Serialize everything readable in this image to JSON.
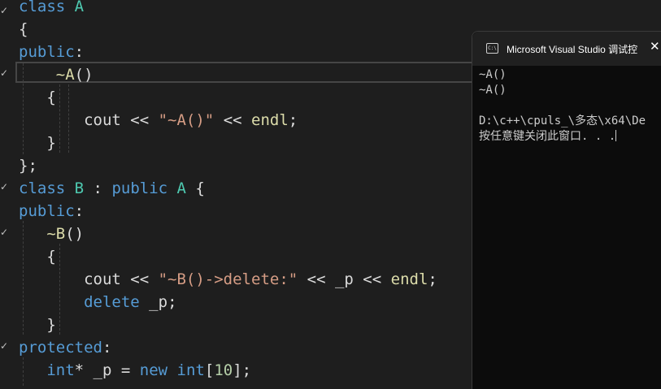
{
  "editor": {
    "lines": [
      {
        "tokens": [
          {
            "c": "k",
            "t": "class"
          },
          {
            "c": "p",
            "t": " "
          },
          {
            "c": "t",
            "t": "A"
          }
        ]
      },
      {
        "tokens": [
          {
            "c": "p",
            "t": "{"
          }
        ]
      },
      {
        "tokens": [
          {
            "c": "k",
            "t": "public"
          },
          {
            "c": "p",
            "t": ":"
          }
        ]
      },
      {
        "tokens": [
          {
            "c": "p",
            "t": "    "
          },
          {
            "c": "f",
            "t": "~A"
          },
          {
            "c": "p",
            "t": "()"
          }
        ]
      },
      {
        "tokens": [
          {
            "c": "p",
            "t": "   {"
          }
        ]
      },
      {
        "tokens": [
          {
            "c": "p",
            "t": "       "
          },
          {
            "c": "v",
            "t": "cout"
          },
          {
            "c": "p",
            "t": " << "
          },
          {
            "c": "s",
            "t": "\"~A()\""
          },
          {
            "c": "p",
            "t": " << "
          },
          {
            "c": "f",
            "t": "endl"
          },
          {
            "c": "p",
            "t": ";"
          }
        ]
      },
      {
        "tokens": [
          {
            "c": "p",
            "t": "   }"
          }
        ]
      },
      {
        "tokens": [
          {
            "c": "p",
            "t": "};"
          }
        ]
      },
      {
        "tokens": [
          {
            "c": "k",
            "t": "class"
          },
          {
            "c": "p",
            "t": " "
          },
          {
            "c": "t",
            "t": "B"
          },
          {
            "c": "p",
            "t": " : "
          },
          {
            "c": "k",
            "t": "public"
          },
          {
            "c": "p",
            "t": " "
          },
          {
            "c": "t",
            "t": "A"
          },
          {
            "c": "p",
            "t": " {"
          }
        ]
      },
      {
        "tokens": [
          {
            "c": "k",
            "t": "public"
          },
          {
            "c": "p",
            "t": ":"
          }
        ]
      },
      {
        "tokens": [
          {
            "c": "p",
            "t": "   "
          },
          {
            "c": "f",
            "t": "~B"
          },
          {
            "c": "p",
            "t": "()"
          }
        ]
      },
      {
        "tokens": [
          {
            "c": "p",
            "t": "   {"
          }
        ]
      },
      {
        "tokens": [
          {
            "c": "p",
            "t": "       "
          },
          {
            "c": "v",
            "t": "cout"
          },
          {
            "c": "p",
            "t": " << "
          },
          {
            "c": "s",
            "t": "\"~B()->delete:\""
          },
          {
            "c": "p",
            "t": " << "
          },
          {
            "c": "v",
            "t": "_p"
          },
          {
            "c": "p",
            "t": " << "
          },
          {
            "c": "f",
            "t": "endl"
          },
          {
            "c": "p",
            "t": ";"
          }
        ]
      },
      {
        "tokens": [
          {
            "c": "p",
            "t": "       "
          },
          {
            "c": "k",
            "t": "delete"
          },
          {
            "c": "p",
            "t": " "
          },
          {
            "c": "v",
            "t": "_p"
          },
          {
            "c": "p",
            "t": ";"
          }
        ]
      },
      {
        "tokens": [
          {
            "c": "p",
            "t": "   }"
          }
        ]
      },
      {
        "tokens": [
          {
            "c": "k",
            "t": "protected"
          },
          {
            "c": "p",
            "t": ":"
          }
        ]
      },
      {
        "tokens": [
          {
            "c": "p",
            "t": "   "
          },
          {
            "c": "k",
            "t": "int"
          },
          {
            "c": "p",
            "t": "* "
          },
          {
            "c": "v",
            "t": "_p"
          },
          {
            "c": "p",
            "t": " = "
          },
          {
            "c": "k",
            "t": "new"
          },
          {
            "c": "p",
            "t": " "
          },
          {
            "c": "k",
            "t": "int"
          },
          {
            "c": "p",
            "t": "["
          },
          {
            "c": "n",
            "t": "10"
          },
          {
            "c": "p",
            "t": "];"
          }
        ]
      }
    ]
  },
  "console": {
    "title": "Microsoft Visual Studio 调试控",
    "icon": "console-app-icon",
    "icon_glyph": "C:\\",
    "close_glyph": "✕",
    "output_lines": [
      "~A()",
      "~A()",
      "",
      "D:\\c++\\cpuls_\\多态\\x64\\De",
      "按任意键关闭此窗口. . ."
    ]
  },
  "colors": {
    "keyword": "#569cd6",
    "type": "#4ec9b0",
    "function": "#dcdcaa",
    "string": "#d69d85",
    "number": "#b5cea8",
    "editor_bg": "#1e1e1e",
    "console_bg": "#0c0c0c"
  }
}
